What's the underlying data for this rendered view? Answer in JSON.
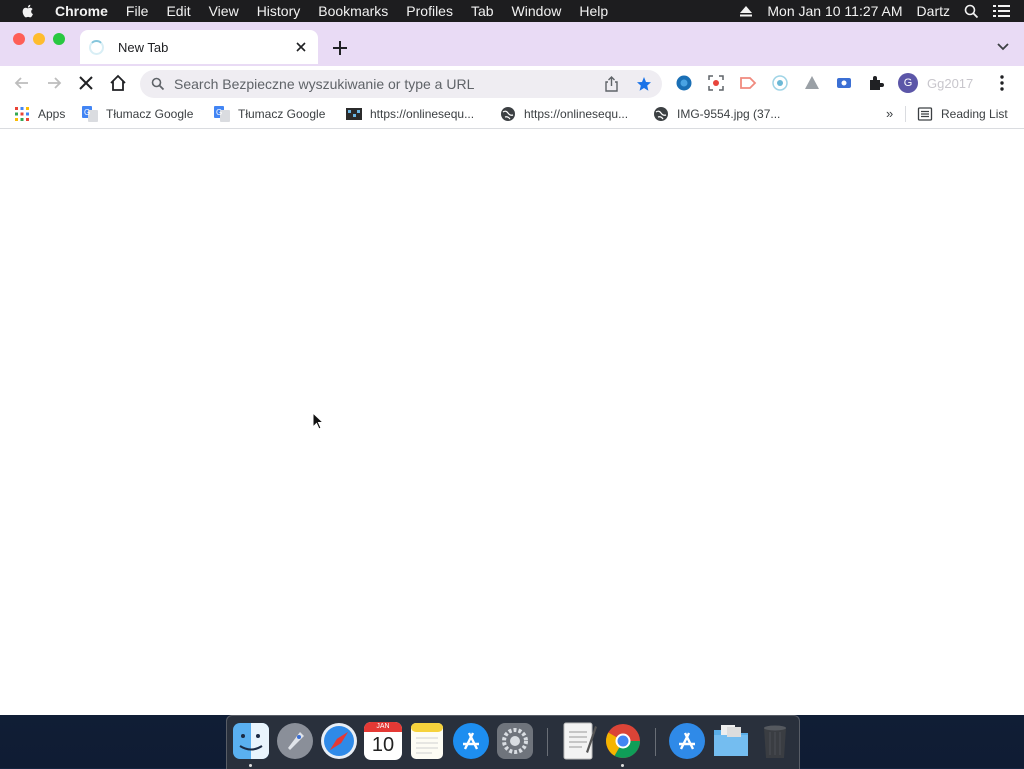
{
  "menubar": {
    "app_name": "Chrome",
    "items": [
      "File",
      "Edit",
      "View",
      "History",
      "Bookmarks",
      "Profiles",
      "Tab",
      "Window",
      "Help"
    ],
    "datetime": "Mon Jan 10  11:27 AM",
    "user": "Dartz"
  },
  "tab": {
    "title": "New Tab"
  },
  "omnibox": {
    "placeholder": "Search Bezpieczne wyszukiwanie or type a URL"
  },
  "profile": {
    "initial": "G",
    "name": "Gg2017"
  },
  "bookmarks": {
    "apps": "Apps",
    "items": [
      {
        "label": "Tłumacz Google",
        "icon": "google-translate-icon"
      },
      {
        "label": "Tłumacz Google",
        "icon": "google-translate-icon"
      },
      {
        "label": "https://onlinesequ...",
        "icon": "sequencer-icon"
      },
      {
        "label": "https://onlinesequ...",
        "icon": "globe-icon"
      },
      {
        "label": "IMG-9554.jpg (37...",
        "icon": "globe-icon"
      }
    ],
    "more": "»",
    "reading_list": "Reading List"
  },
  "dock": {
    "calendar_month": "JAN",
    "calendar_day": "10",
    "apps": [
      "finder",
      "launchpad",
      "safari",
      "calendar",
      "notes",
      "app-store",
      "system-preferences",
      "textedit",
      "chrome",
      "applications-folder",
      "downloads-folder",
      "trash"
    ]
  },
  "colors": {
    "tabstrip": "#e9dbf5",
    "accent": "#1a73e8",
    "avatar": "#5c56a8"
  }
}
